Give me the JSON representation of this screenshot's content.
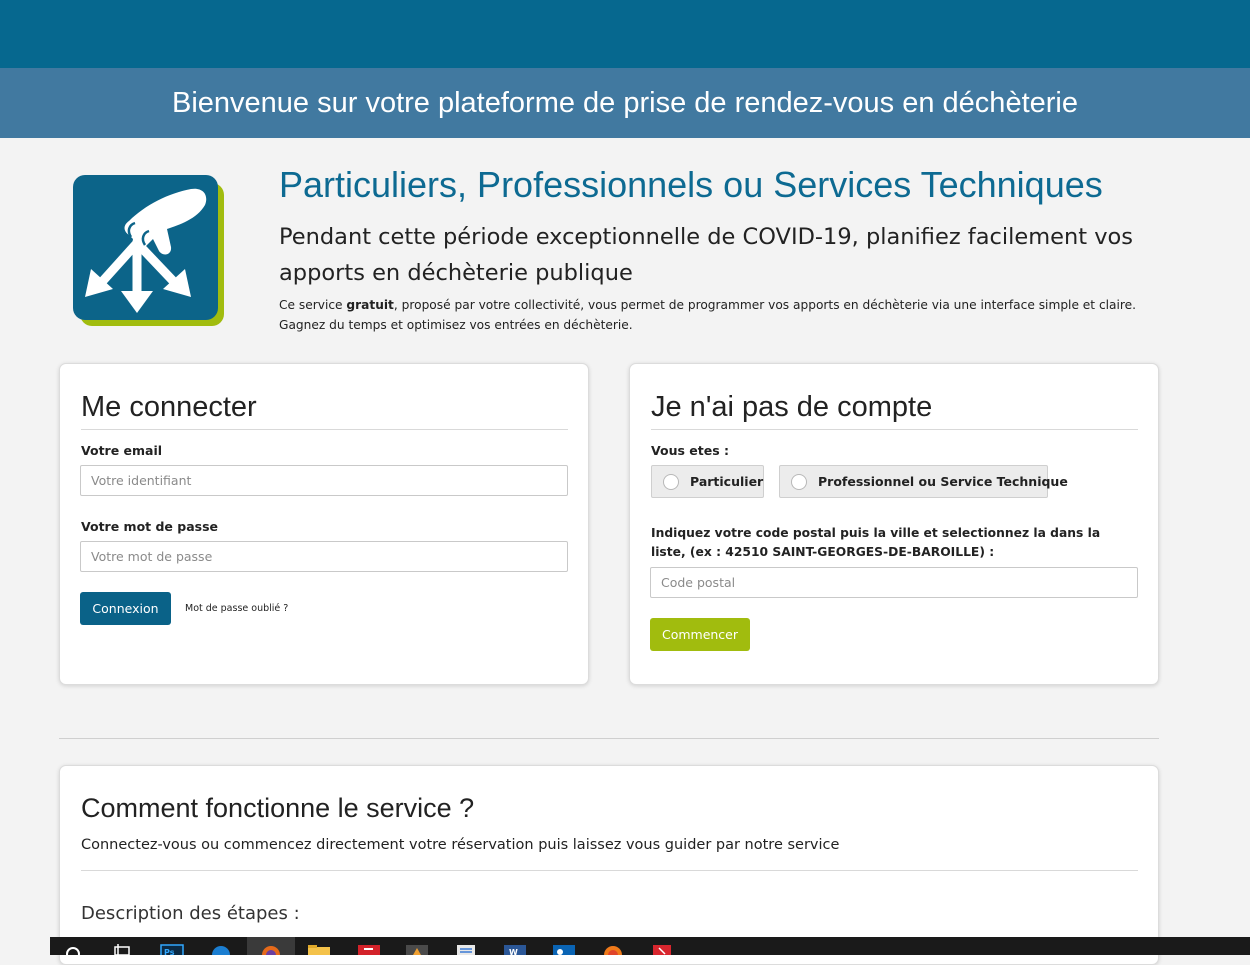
{
  "header": {
    "welcome": "Bienvenue sur votre plateforme de prise de rendez-vous en déchèterie"
  },
  "hero": {
    "title": "Particuliers, Professionnels ou Services Techniques",
    "subtitle": "Pendant cette période exceptionnelle de COVID-19, planifiez facilement vos apports en déchèterie publique",
    "desc_before": "Ce service ",
    "desc_bold": "gratuit",
    "desc_after": ", proposé par votre collectivité, vous permet de programmer vos apports en déchèterie via une interface simple et claire. Gagnez du temps et optimisez vos entrées en déchèterie."
  },
  "login": {
    "title": "Me connecter",
    "email_label": "Votre email",
    "email_placeholder": "Votre identifiant",
    "email_value": "",
    "password_label": "Votre mot de passe",
    "password_placeholder": "Votre mot de passe",
    "password_value": "",
    "submit_label": "Connexion",
    "forgot_label": "Mot de passe oublié ?"
  },
  "register": {
    "title": "Je n'ai pas de compte",
    "type_label": "Vous etes :",
    "options": [
      "Particulier",
      "Professionnel ou Service Technique"
    ],
    "postal_label": "Indiquez votre code postal puis la ville et selectionnez la dans la liste, (ex : 42510 SAINT-GEORGES-DE-BAROILLE) :",
    "postal_placeholder": "Code postal",
    "postal_value": "",
    "start_label": "Commencer"
  },
  "how": {
    "title": "Comment fonctionne le service ?",
    "text": "Connectez-vous ou commencez directement votre réservation puis laissez vous guider par notre service",
    "steps_title": "Description des étapes :"
  },
  "colors": {
    "topbar": "#06688f",
    "welcome_band": "#4179a0",
    "title_blue": "#0d6a92",
    "primary_button": "#0a6288",
    "accent_green": "#a1bc0e"
  },
  "taskbar": {
    "icons": [
      "search-icon",
      "task-view-icon",
      "photoshop-icon",
      "edge-icon",
      "firefox-icon",
      "file-explorer-icon",
      "app-red-icon",
      "app-dark-icon",
      "notepad-icon",
      "word-icon",
      "outlook-icon",
      "firefox-alt-icon",
      "pdf-icon"
    ]
  }
}
